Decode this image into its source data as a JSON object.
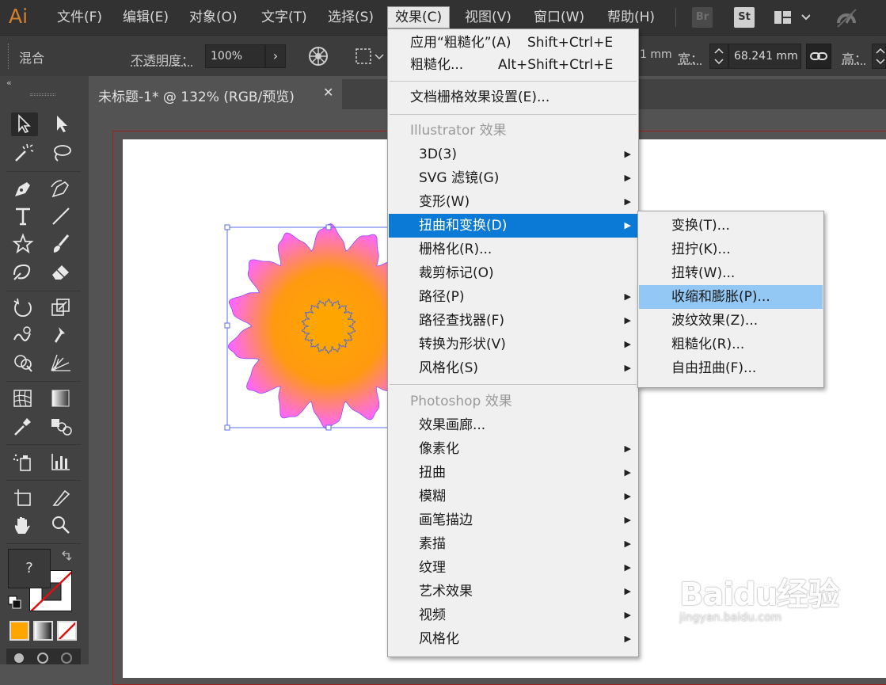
{
  "app": {
    "logo": "Ai"
  },
  "menubar": {
    "items": [
      "文件(F)",
      "编辑(E)",
      "对象(O)",
      "文字(T)",
      "选择(S)",
      "效果(C)",
      "视图(V)",
      "窗口(W)",
      "帮助(H)"
    ],
    "active": "效果(C)",
    "bridge": "Br",
    "stock": "St"
  },
  "controlbar": {
    "blend_label": "混合",
    "opacity_label": "不透明度：",
    "opacity_value": "100%",
    "x_fragment": "1 mm",
    "width_label": "宽：",
    "width_value": "68.241 mm",
    "height_label": "高："
  },
  "document_tab": {
    "title": "未标题-1* @ 132% (RGB/预览)",
    "close": "✕"
  },
  "toolbar": {
    "collapse": "«",
    "unknown_swatch": "?"
  },
  "effect_menu": {
    "apply_label": "应用“粗糙化”(A)",
    "apply_shortcut": "Shift+Ctrl+E",
    "roughen_label": "粗糙化...",
    "roughen_shortcut": "Alt+Shift+Ctrl+E",
    "raster_settings": "文档栅格效果设置(E)...",
    "illustrator_header": "Illustrator 效果",
    "illustrator_items": [
      "3D(3)",
      "SVG 滤镜(G)",
      "变形(W)",
      "扭曲和变换(D)",
      "栅格化(R)...",
      "裁剪标记(O)",
      "路径(P)",
      "路径查找器(F)",
      "转换为形状(V)",
      "风格化(S)"
    ],
    "photoshop_header": "Photoshop 效果",
    "photoshop_items": [
      "效果画廊...",
      "像素化",
      "扭曲",
      "模糊",
      "画笔描边",
      "素描",
      "纹理",
      "艺术效果",
      "视频",
      "风格化"
    ],
    "highlighted": "扭曲和变换(D)"
  },
  "distort_submenu": {
    "items": [
      "变换(T)...",
      "扭拧(K)...",
      "扭转(W)...",
      "收缩和膨胀(P)...",
      "波纹效果(Z)...",
      "粗糙化(R)...",
      "自由扭曲(F)..."
    ],
    "highlighted": "收缩和膨胀(P)..."
  },
  "watermark": {
    "main": "Baidu经验",
    "sub": "jingyan.baidu.com"
  },
  "colors": {
    "fill": "#ffa500",
    "stroke_none": "#ff0000",
    "gradient_outer": "#ff66ff",
    "accent_blue": "#0b7ad6"
  }
}
